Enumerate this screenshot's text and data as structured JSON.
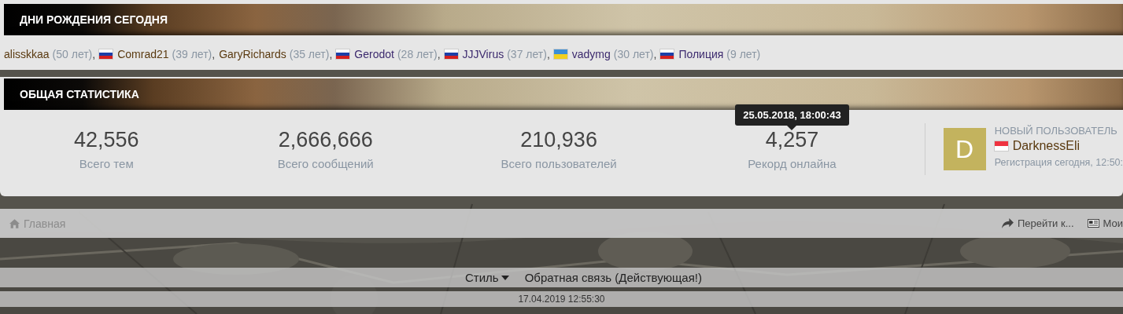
{
  "birthdays": {
    "title": "ДНИ РОЖДЕНИЯ СЕГОДНЯ",
    "users": [
      {
        "name": "alisskkaa",
        "age": "(50 лет)",
        "separator": ",",
        "kind": "no_flag",
        "color": "#5a3a10"
      },
      {
        "name": "Comrad21",
        "age": "(39 лет)",
        "separator": ",",
        "kind": "ru_flag",
        "color": "#5a3a10"
      },
      {
        "name": "GaryRichards",
        "age": "(35 лет)",
        "separator": ",",
        "kind": "no_flag",
        "color": "#5a3a10"
      },
      {
        "name": "Gerodot",
        "age": "(28 лет)",
        "separator": ",",
        "kind": "ru_flag",
        "color": "#3c2a6e"
      },
      {
        "name": "JJJVirus",
        "age": "(37 лет)",
        "separator": ",",
        "kind": "ru_flag",
        "color": "#3c2a6e"
      },
      {
        "name": "vadymg",
        "age": "(30 лет)",
        "separator": ",",
        "kind": "ua_flag",
        "color": "#3c2a6e"
      },
      {
        "name": "Полиция",
        "age": "(9 лет)",
        "kind": "ru_flag",
        "color": "#3c2a6e"
      }
    ]
  },
  "statistics": {
    "title": "ОБЩАЯ СТАТИСТИКА",
    "stats": [
      {
        "value": "42,556",
        "label": "Всего тем"
      },
      {
        "value": "2,666,666",
        "label": "Всего сообщений"
      },
      {
        "value": "210,936",
        "label": "Всего пользователей"
      },
      {
        "value": "4,257",
        "label": "Рекорд онлайна",
        "tooltip": "25.05.2018, 18:00:43"
      }
    ],
    "new_user": {
      "heading": "НОВЫЙ ПОЛЬЗОВАТЕЛЬ",
      "avatar_letter": "D",
      "kind": "sg_flag",
      "name": "DarknessEli",
      "registered": "Регистрация сегодня, 12:50:"
    }
  },
  "nav": {
    "home": "Главная",
    "goto": "Перейти к...",
    "mine": "Мои"
  },
  "footer": {
    "style": "Стиль",
    "feedback": "Обратная связь (Действующая!)",
    "date": "17.04.2019 12:55:30"
  }
}
